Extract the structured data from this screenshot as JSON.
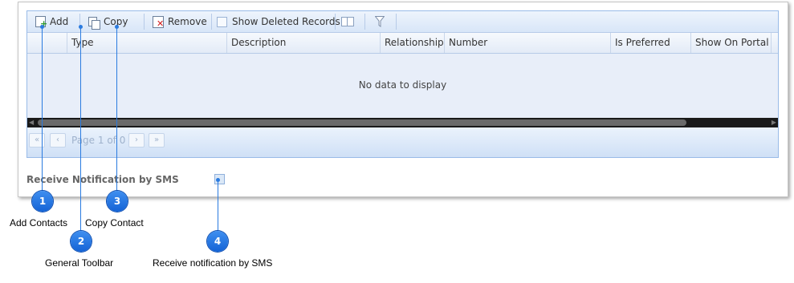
{
  "toolbar": {
    "add_label": "Add",
    "copy_label": "Copy",
    "remove_label": "Remove",
    "show_deleted_label": "Show Deleted Records"
  },
  "columns": [
    "Type",
    "Description",
    "Relationship",
    "Number",
    "Is Preferred",
    "Show On Portal"
  ],
  "grid": {
    "empty_text": "No data to display"
  },
  "pager": {
    "page_text": "Page 1 of 0"
  },
  "sms": {
    "label": "Receive Notification by SMS"
  },
  "callouts": [
    {
      "number": "1",
      "text": "Add Contacts"
    },
    {
      "number": "2",
      "text": "General Toolbar"
    },
    {
      "number": "3",
      "text": "Copy Contact"
    },
    {
      "number": "4",
      "text": "Receive notification by SMS"
    }
  ],
  "colors": {
    "callout": "#2a7be0",
    "grid_border": "#99bbe8",
    "grid_bg": "#e8eef9"
  }
}
